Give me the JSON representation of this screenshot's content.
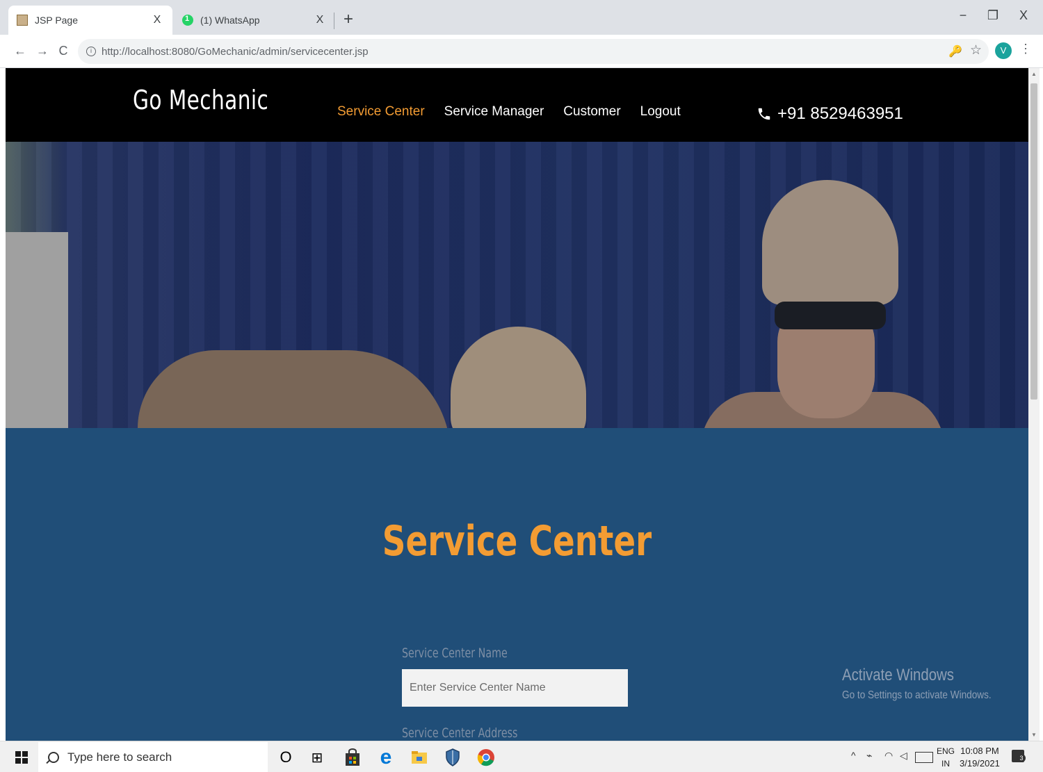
{
  "browser": {
    "tabs": [
      {
        "title": "JSP Page",
        "close": "X",
        "active": true
      },
      {
        "title": "(1) WhatsApp",
        "close": "X",
        "active": false
      }
    ],
    "new_tab": "+",
    "window_controls": {
      "minimize": "−",
      "maximize": "❐",
      "close": "X"
    },
    "nav": {
      "back": "←",
      "forward": "→",
      "reload": "C"
    },
    "url_info": "i",
    "url": "http://localhost:8080/GoMechanic/admin/servicecenter.jsp",
    "key_icon": "🔑",
    "star_icon": "☆",
    "profile_initial": "V",
    "menu_icon": "⋮"
  },
  "site": {
    "brand": "Go Mechanic",
    "menu": [
      {
        "label": "Service Center",
        "active": true
      },
      {
        "label": "Service Manager",
        "active": false
      },
      {
        "label": "Customer",
        "active": false
      },
      {
        "label": "Logout",
        "active": false
      }
    ],
    "phone": "+91 8529463951",
    "accent_color": "#f39c33",
    "section_bg": "#204e78"
  },
  "form": {
    "title": "Service Center",
    "fields": [
      {
        "label": "Service Center Name",
        "placeholder": "Enter Service Center Name"
      },
      {
        "label": "Service Center Address"
      }
    ]
  },
  "watermark": {
    "title": "Activate Windows",
    "subtitle": "Go to Settings to activate Windows."
  },
  "taskbar": {
    "search_placeholder": "Type here to search",
    "cortana": "O",
    "task_view": "⊞",
    "apps": [
      "store-icon",
      "edge-icon",
      "file-explorer-icon",
      "defender-icon",
      "chrome-icon"
    ],
    "tray_chevron": "^",
    "language": "ENG",
    "region": "IN",
    "time": "10:08 PM",
    "date": "3/19/2021",
    "notification_count": "3"
  }
}
